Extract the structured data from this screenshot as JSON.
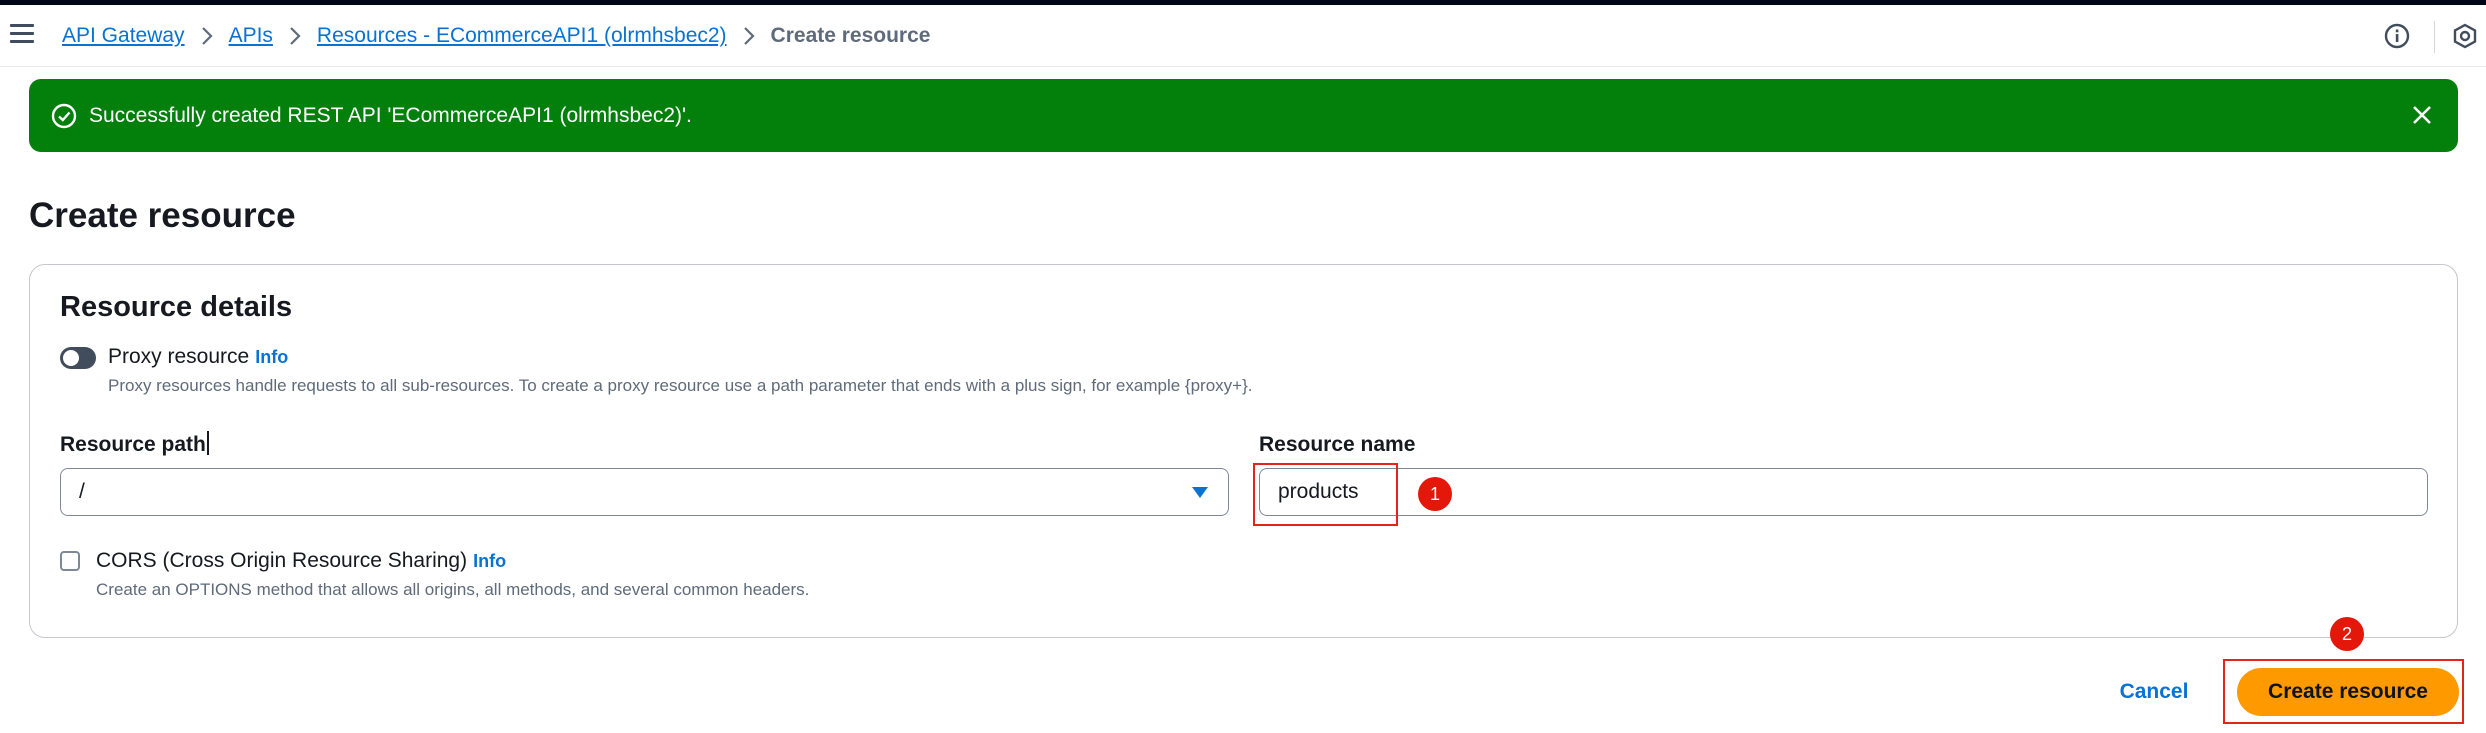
{
  "breadcrumbs": [
    {
      "label": "API Gateway"
    },
    {
      "label": "APIs"
    },
    {
      "label": "Resources - ECommerceAPI1 (olrmhsbec2)"
    },
    {
      "label": "Create resource"
    }
  ],
  "icons": {
    "menu": "hamburger-menu-icon",
    "info": "info-circle-icon",
    "settings": "settings-hex-icon",
    "success": "check-circle-icon",
    "close": "close-icon",
    "caret": "caret-down-icon"
  },
  "flash": {
    "message": "Successfully created REST API 'ECommerceAPI1 (olrmhsbec2)'.",
    "color": "#037f0c"
  },
  "page": {
    "title": "Create resource"
  },
  "resource_details": {
    "title": "Resource details",
    "proxy": {
      "label": "Proxy resource",
      "info": "Info",
      "description": "Proxy resources handle requests to all sub-resources. To create a proxy resource use a path parameter that ends with a plus sign, for example {proxy+}.",
      "enabled": false
    },
    "resource_path": {
      "label": "Resource path",
      "value": "/"
    },
    "resource_name": {
      "label": "Resource name",
      "value": "products"
    },
    "cors": {
      "label": "CORS (Cross Origin Resource Sharing)",
      "info": "Info",
      "description": "Create an OPTIONS method that allows all origins, all methods, and several common headers.",
      "checked": false
    }
  },
  "actions": {
    "cancel": "Cancel",
    "submit": "Create resource",
    "submit_color": "#ff9900"
  },
  "annotations": [
    {
      "label": "1"
    },
    {
      "label": "2"
    }
  ],
  "colors": {
    "link": "#0972d3",
    "annotation": "#e3170a"
  }
}
